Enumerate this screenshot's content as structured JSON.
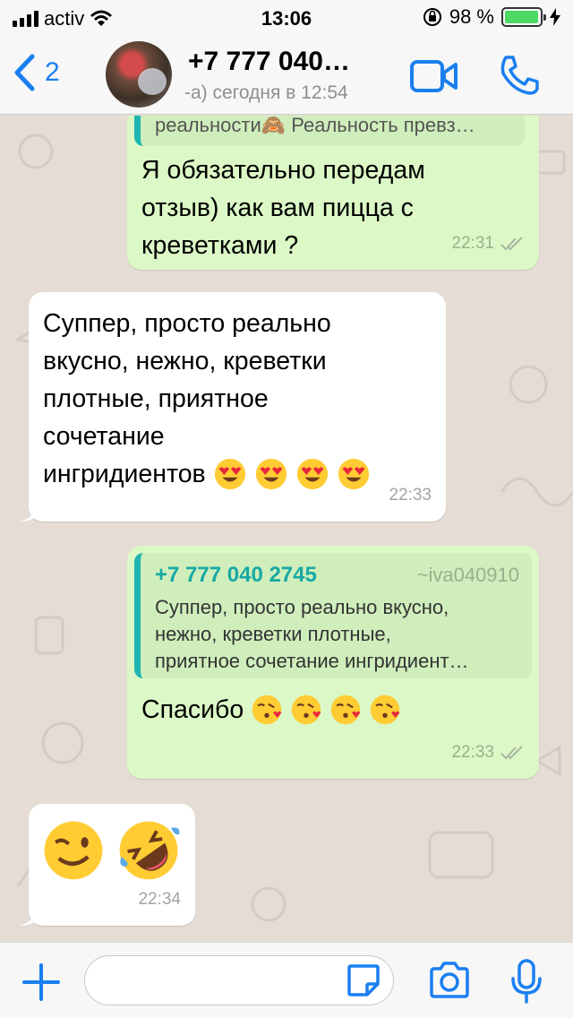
{
  "status_bar": {
    "carrier": "activ",
    "time": "13:06",
    "battery": "98 %",
    "battery_level": 0.98
  },
  "header": {
    "back_count": "2",
    "contact_name": "+7 777 040…",
    "last_seen": "-а) сегодня в 12:54"
  },
  "messages": [
    {
      "direction": "out",
      "quote_cut": "реальности🙈 Реальность превз…",
      "text_lines": [
        "Я обязательно передам",
        "отзыв) как вам пицца с",
        "креветками ?"
      ],
      "time": "22:31"
    },
    {
      "direction": "in",
      "text_lines": [
        "Суппер, просто реально",
        "вкусно, нежно, креветки",
        "плотные, приятное",
        "сочетание",
        "ингридиентов"
      ],
      "emojis": [
        "heart-eyes",
        "heart-eyes",
        "heart-eyes",
        "heart-eyes"
      ],
      "time": "22:33"
    },
    {
      "direction": "out",
      "quote": {
        "phone": "+7 777 040 2745",
        "nick": "~iva040910",
        "lines": [
          "Суппер, просто реально вкусно,",
          "нежно, креветки плотные,",
          "приятное сочетание ингридиент…"
        ]
      },
      "text": "Спасибо",
      "emojis": [
        "kiss-heart",
        "kiss-heart",
        "kiss-heart",
        "kiss-heart"
      ],
      "time": "22:33"
    },
    {
      "direction": "in",
      "emojis": [
        "wink",
        "rofl"
      ],
      "time": "22:34"
    }
  ],
  "colors": {
    "accent": "#1a7ff0",
    "outgoing_bubble": "#dcf8c6",
    "incoming_bubble": "#ffffff",
    "chat_background": "#e5ddd5",
    "quote_accent": "#1fb6b0"
  },
  "icons": {
    "back": "chevron-left-icon",
    "video": "video-call-icon",
    "phone": "phone-icon",
    "attach": "plus-icon",
    "sticker": "sticker-icon",
    "camera": "camera-icon",
    "mic": "microphone-icon"
  }
}
